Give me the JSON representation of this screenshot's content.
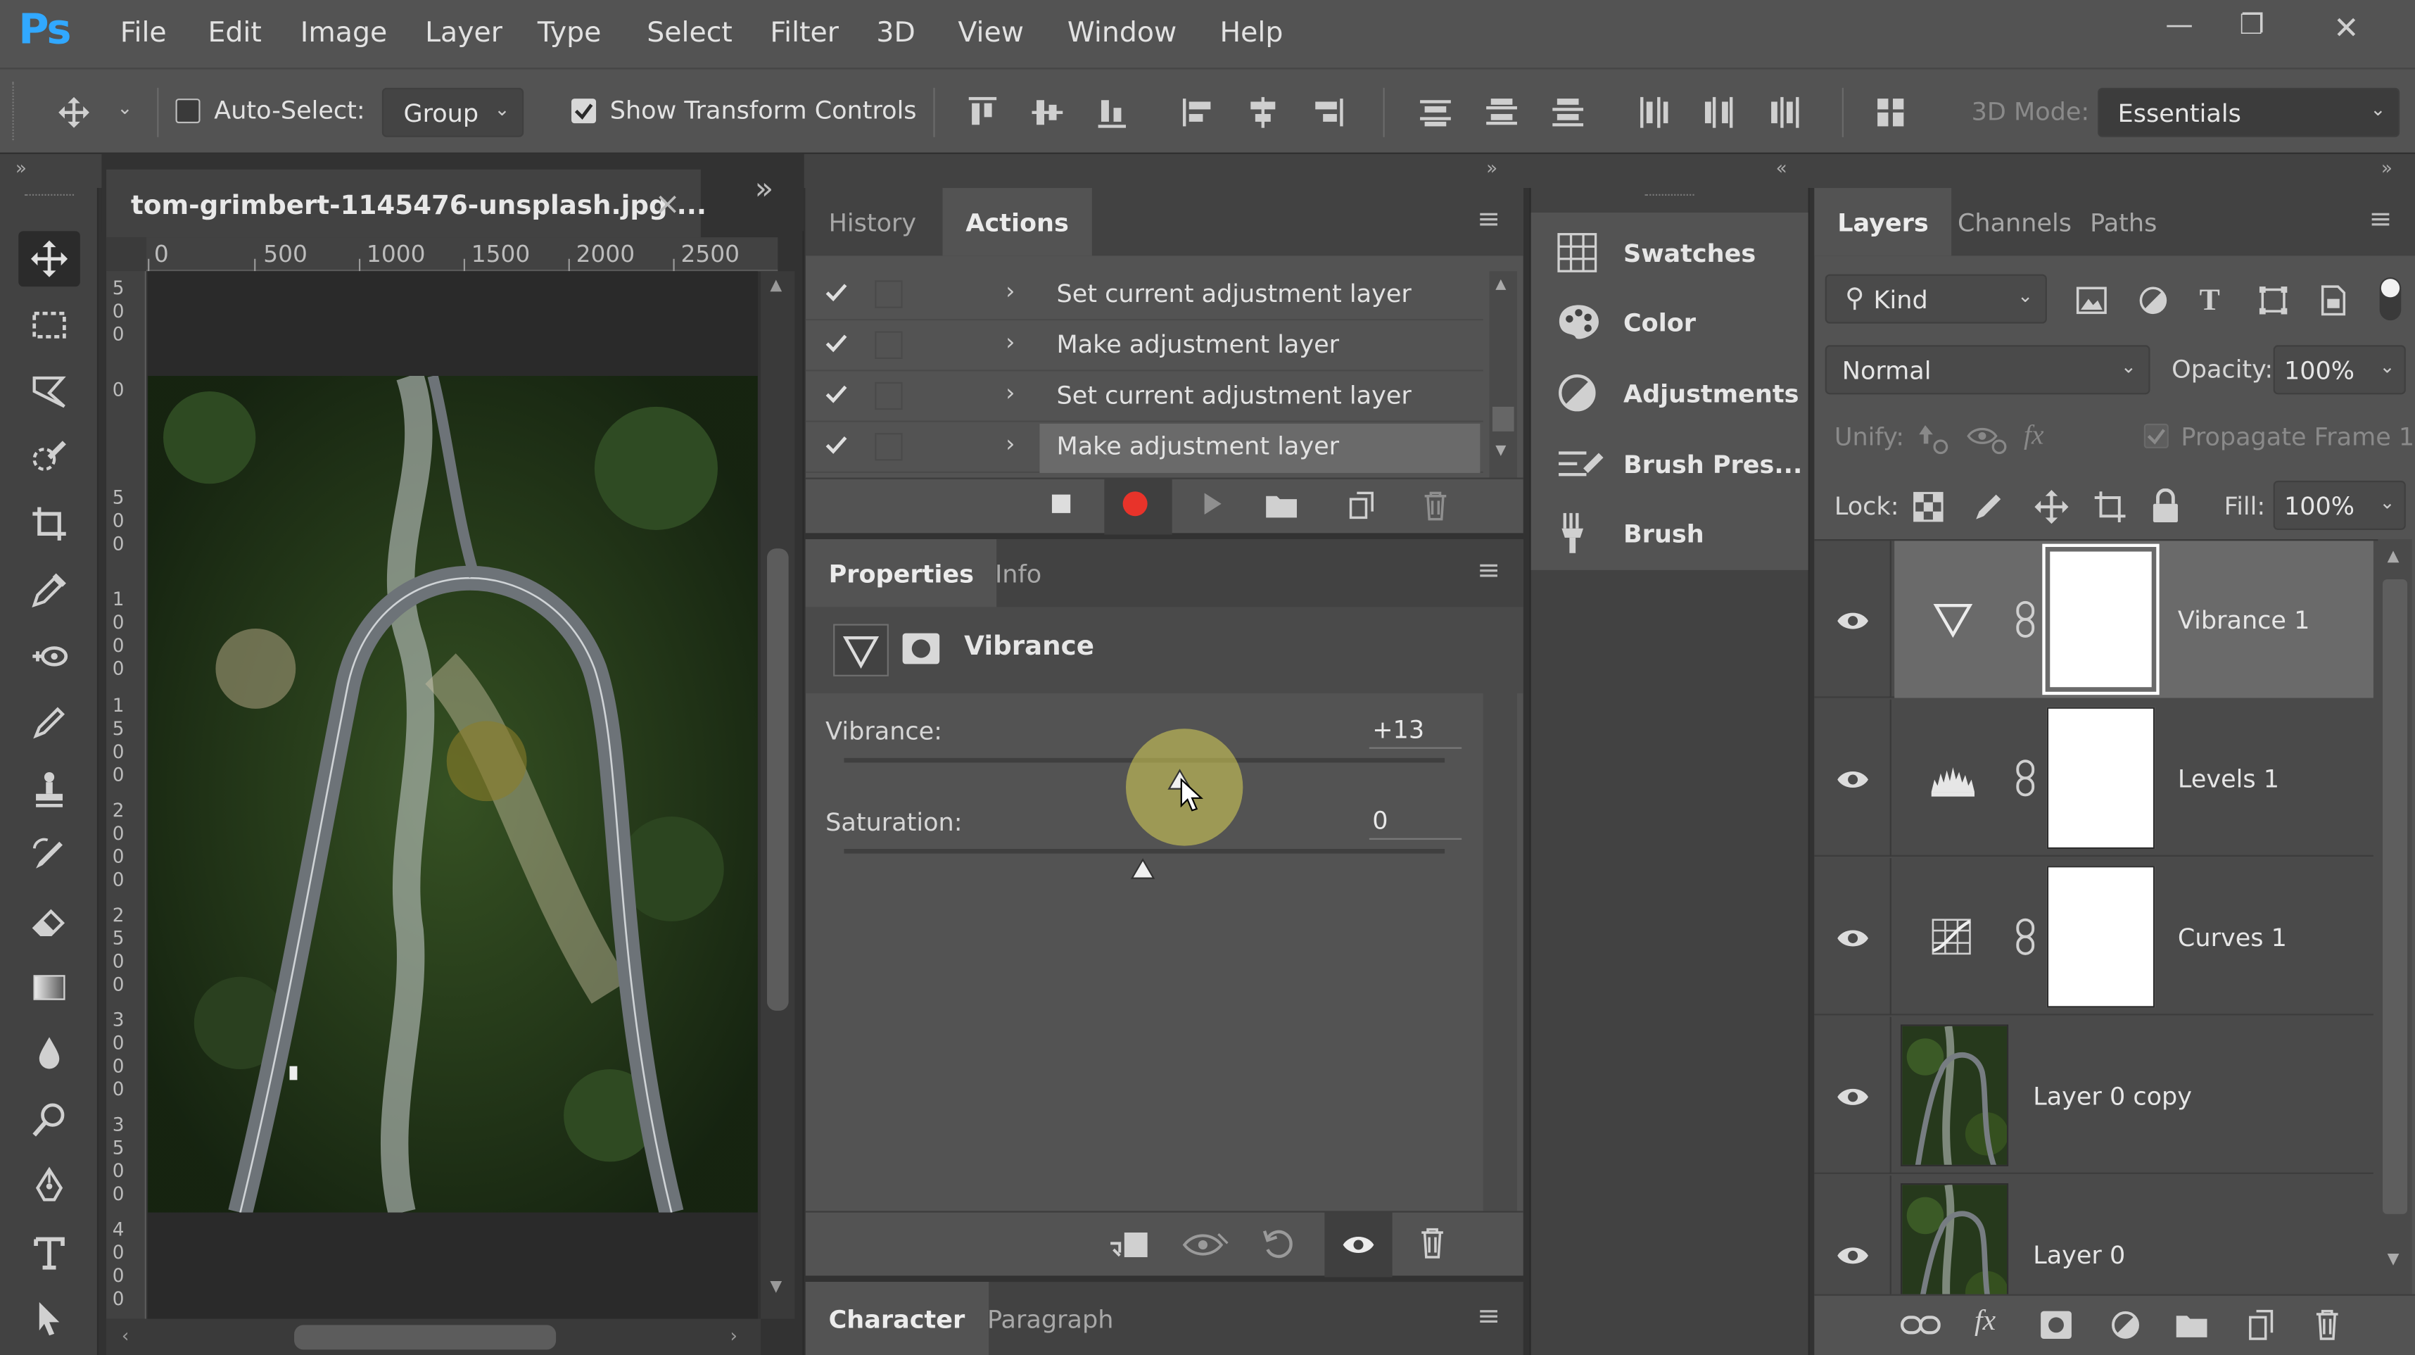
{
  "app": {
    "logo": "Ps"
  },
  "menu": [
    "File",
    "Edit",
    "Image",
    "Layer",
    "Type",
    "Select",
    "Filter",
    "3D",
    "View",
    "Window",
    "Help"
  ],
  "window_controls": {
    "minimize": "—",
    "restore": "❐",
    "close": "✕"
  },
  "options_bar": {
    "auto_select_label": "Auto-Select:",
    "auto_select_checked": false,
    "group_value": "Group",
    "show_transform_label": "Show Transform Controls",
    "show_transform_checked": true,
    "mode_label": "3D Mode:",
    "workspace_value": "Essentials"
  },
  "document": {
    "tab_title": "tom-grimbert-1145476-unsplash.jpg ...",
    "close_glyph": "×",
    "expand_glyph": "»",
    "ruler_h": [
      "0",
      "500",
      "1000",
      "1500",
      "2000",
      "2500"
    ],
    "ruler_v": [
      "500",
      "0",
      "500",
      "1000",
      "1500",
      "2000",
      "2500",
      "3000",
      "3500",
      "4000"
    ]
  },
  "actions_panel": {
    "tabs": [
      "History",
      "Actions"
    ],
    "active_tab": "Actions",
    "items": [
      {
        "label": "Set current adjustment layer",
        "checked": true
      },
      {
        "label": "Make adjustment layer",
        "checked": true
      },
      {
        "label": "Set current adjustment layer",
        "checked": true
      },
      {
        "label": "Make adjustment layer",
        "checked": true,
        "selected": true
      }
    ]
  },
  "properties_panel": {
    "tabs": [
      "Properties",
      "Info"
    ],
    "active_tab": "Properties",
    "adjustment_title": "Vibrance",
    "vibrance_label": "Vibrance:",
    "vibrance_value": "+13",
    "vibrance_level": 0.57,
    "saturation_label": "Saturation:",
    "saturation_value": "0",
    "saturation_level": 0.5
  },
  "character_panel": {
    "tabs": [
      "Character",
      "Paragraph"
    ],
    "active_tab": "Character"
  },
  "mini_panels": [
    "Swatches",
    "Color",
    "Adjustments",
    "Brush Pres...",
    "Brush"
  ],
  "layers_panel": {
    "tabs": [
      "Layers",
      "Channels",
      "Paths"
    ],
    "active_tab": "Layers",
    "filter_label": "Kind",
    "blend_mode": "Normal",
    "opacity_label": "Opacity:",
    "opacity_value": "100%",
    "unify_label": "Unify:",
    "propagate_label": "Propagate Frame 1",
    "lock_label": "Lock:",
    "fill_label": "Fill:",
    "fill_value": "100%",
    "layers": [
      {
        "name": "Vibrance 1",
        "kind": "vibrance",
        "selected": true
      },
      {
        "name": "Levels 1",
        "kind": "levels"
      },
      {
        "name": "Curves 1",
        "kind": "curves"
      },
      {
        "name": "Layer 0 copy",
        "kind": "image"
      },
      {
        "name": "Layer 0",
        "kind": "image"
      }
    ]
  },
  "colors": {
    "accent": "#31a8ff",
    "record": "#e8332a",
    "panel": "#535353",
    "bg": "#323232"
  }
}
